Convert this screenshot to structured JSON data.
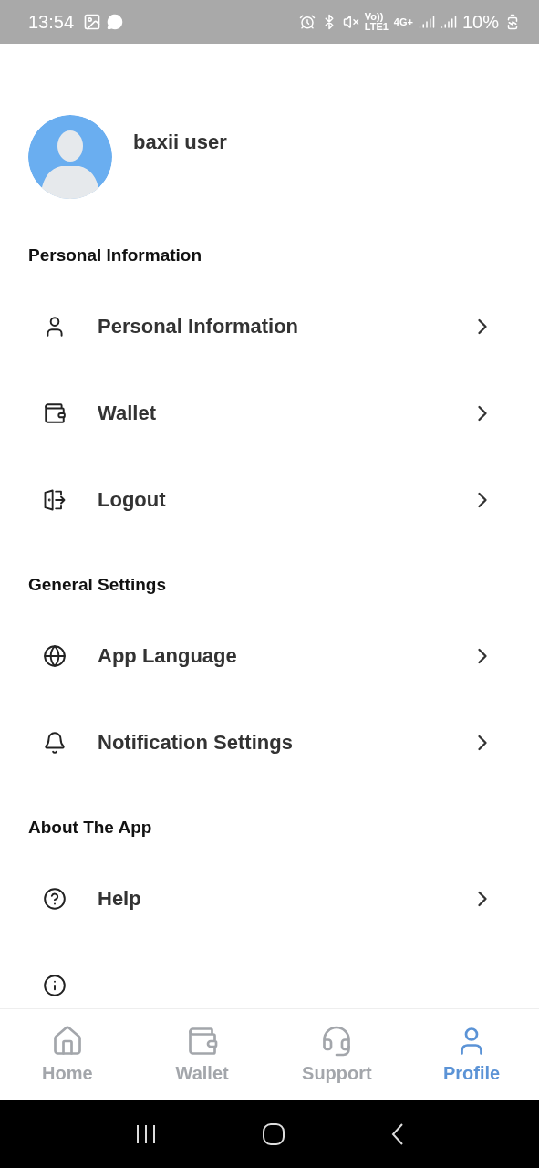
{
  "status_bar": {
    "time": "13:54",
    "network_top": "Vo))",
    "network_bottom": "LTE1",
    "data_type": "4G+",
    "battery": "10%"
  },
  "profile": {
    "name": "baxii user"
  },
  "sections": [
    {
      "title": "Personal Information",
      "items": [
        {
          "label": "Personal Information"
        },
        {
          "label": "Wallet"
        },
        {
          "label": "Logout"
        }
      ]
    },
    {
      "title": "General Settings",
      "items": [
        {
          "label": "App Language"
        },
        {
          "label": "Notification Settings"
        }
      ]
    },
    {
      "title": "About The App",
      "items": [
        {
          "label": "Help"
        }
      ]
    }
  ],
  "bottom_nav": [
    {
      "label": "Home",
      "selected": false
    },
    {
      "label": "Wallet",
      "selected": false
    },
    {
      "label": "Support",
      "selected": false
    },
    {
      "label": "Profile",
      "selected": true
    }
  ]
}
